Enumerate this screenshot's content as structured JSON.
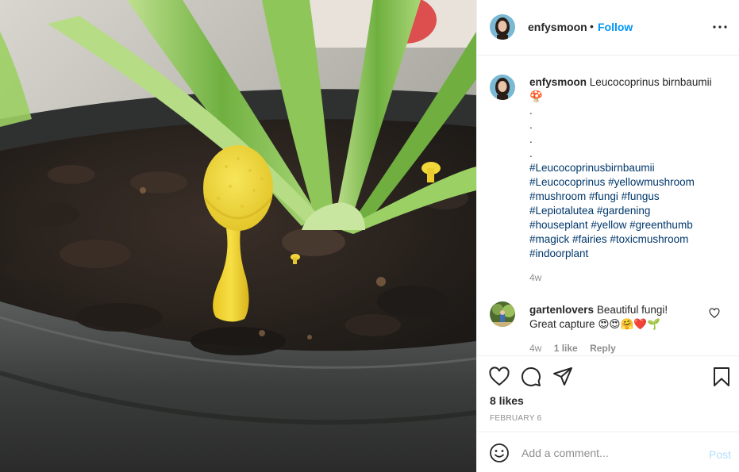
{
  "header": {
    "username": "enfysmoon",
    "separator": "•",
    "follow_label": "Follow"
  },
  "caption": {
    "username": "enfysmoon",
    "text": "Leucocoprinus birnbaumii",
    "emoji": "🍄",
    "dots": [
      ".",
      ".",
      ".",
      "."
    ],
    "hashtag_lines": [
      [
        "#Leucocoprinusbirnbaumii"
      ],
      [
        "#Leucocoprinus",
        "#yellowmushroom"
      ],
      [
        "#mushroom",
        "#fungi",
        "#fungus"
      ],
      [
        "#Lepiotalutea",
        "#gardening"
      ],
      [
        "#houseplant",
        "#yellow",
        "#greenthumb"
      ],
      [
        "#magick",
        "#fairies",
        "#toxicmushroom"
      ],
      [
        "#indoorplant"
      ]
    ],
    "time_ago": "4w"
  },
  "comment": {
    "username": "gartenlovers",
    "text_line1": "Beautiful fungi!",
    "text_line2": "Great capture",
    "emojis": "😍😍🤗❤️🌱",
    "time_ago": "4w",
    "likes": "1 like",
    "reply_label": "Reply"
  },
  "actions": {
    "icons": [
      "heart-icon",
      "comment-icon",
      "share-icon",
      "bookmark-icon"
    ],
    "likes": "8 likes",
    "date": "FEBRUARY 6"
  },
  "add_comment": {
    "placeholder": "Add a comment...",
    "post_label": "Post"
  },
  "colors": {
    "link_blue": "#0095f6",
    "hashtag_blue": "#00376b",
    "muted_gray": "#8e8e8e",
    "post_disabled": "#b2dffc",
    "border": "#efefef"
  }
}
